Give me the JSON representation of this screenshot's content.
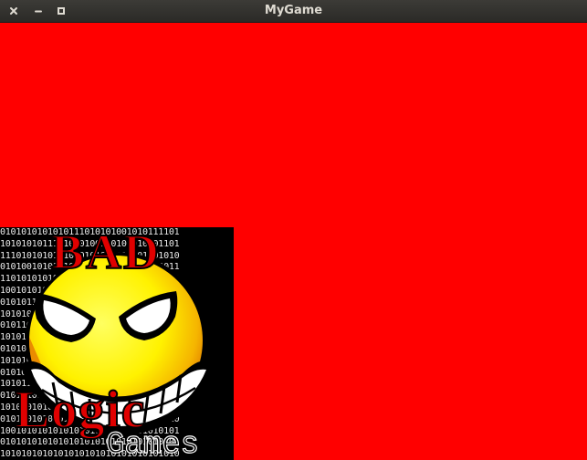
{
  "window": {
    "title": "MyGame",
    "close_icon": "close-icon",
    "minimize_icon": "minimize-icon",
    "maximize_icon": "maximize-icon"
  },
  "game": {
    "clear_color": "#ff0000"
  },
  "logo": {
    "word_top": "BAD",
    "word_middle": "Logic",
    "word_bottom": "Games",
    "binary_rows": [
      "0101010101010111010101001010111101",
      "1010101011101010100110101010101101",
      "1110101010111010101011011101001010",
      "0101001010101011010101010101010011",
      "1101010101010010101101010101011010",
      "1001010101011010101010101010010101",
      "0101011010101010101101010100101010",
      "1010101010110101010101011010101010",
      "0101101010101010101010101011010101",
      "1010101101010101101010101010101010",
      "0101010101010101010101101010101011",
      "1010101010100101010110101010101010",
      "0101010101101010101010101010100101",
      "1010110101010101010101010110101010",
      "0101010101010101101010101010101010",
      "1010101010101010101010101010101001",
      "0101101010101010101010101010101010",
      "1001010101010101010101010101010101",
      "0101010101010101010101010101010101",
      "1010101010101010101010101010101010"
    ]
  }
}
